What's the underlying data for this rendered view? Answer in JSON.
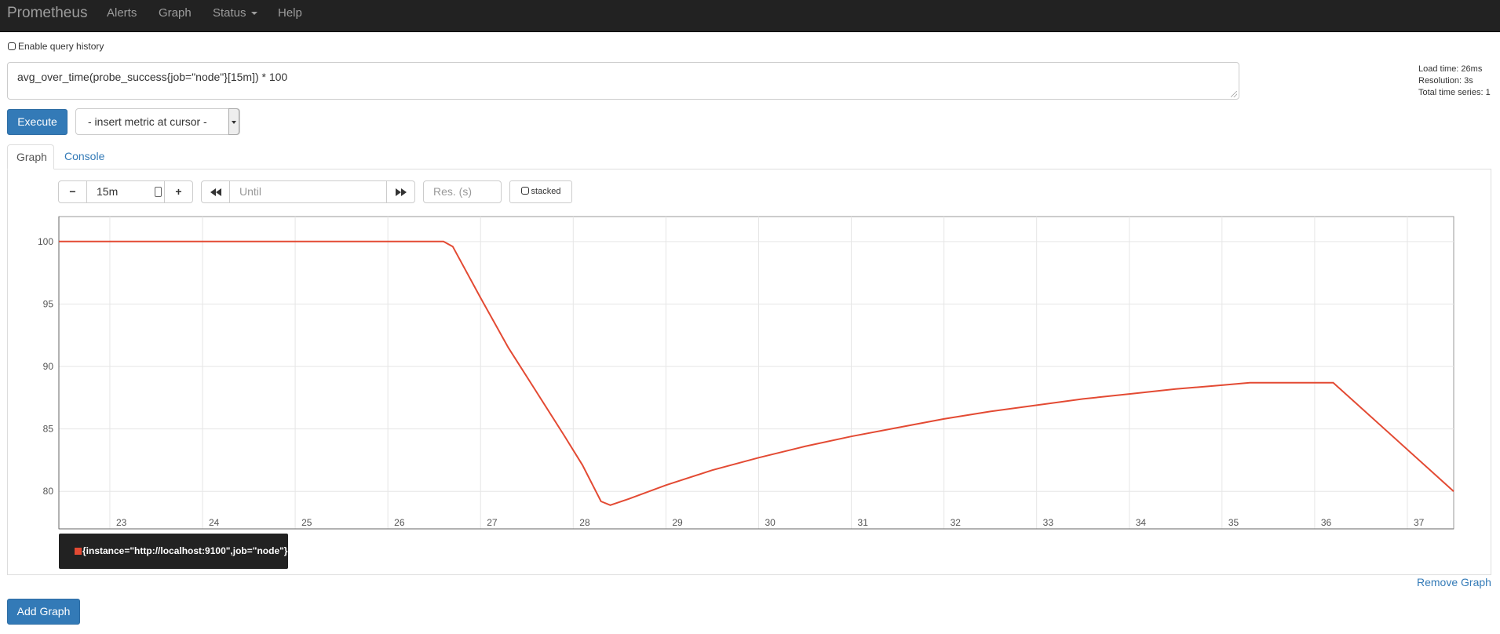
{
  "navbar": {
    "brand": "Prometheus",
    "items": [
      {
        "label": "Alerts"
      },
      {
        "label": "Graph"
      },
      {
        "label": "Status"
      },
      {
        "label": "Help"
      }
    ]
  },
  "query_history": {
    "label": "Enable query history",
    "checked": false
  },
  "expression": {
    "value": "avg_over_time(probe_success{job=\"node\"}[15m]) * 100"
  },
  "stats": {
    "load_time": "Load time: 26ms",
    "resolution": "Resolution: 3s",
    "total_series": "Total time series: 1"
  },
  "execute_label": "Execute",
  "metric_select": {
    "value": "- insert metric at cursor -"
  },
  "tabs": [
    {
      "label": "Graph",
      "active": true
    },
    {
      "label": "Console",
      "active": false
    }
  ],
  "controls": {
    "range_minus": "−",
    "range_value": "15m",
    "range_plus": "+",
    "until_placeholder": "Until",
    "res_placeholder": "Res. (s)",
    "stacked_label": "stacked"
  },
  "chart_data": {
    "type": "line",
    "x_tick_labels": [
      "23",
      "24",
      "25",
      "26",
      "27",
      "28",
      "29",
      "30",
      "31",
      "32",
      "33",
      "34",
      "35",
      "36",
      "37"
    ],
    "y_tick_labels": [
      "100",
      "95",
      "90",
      "85",
      "80"
    ],
    "xlim": [
      22.45,
      37.5
    ],
    "ylim": [
      77,
      102
    ],
    "grid": true,
    "color": "#e34a33",
    "series": [
      {
        "name": "{instance=\"http://localhost:9100\",job=\"node\"}",
        "x": [
          22.45,
          26.6,
          26.7,
          27.0,
          27.3,
          27.6,
          27.9,
          28.1,
          28.3,
          28.4,
          28.6,
          29.0,
          29.5,
          30.0,
          30.5,
          31.0,
          31.5,
          32.0,
          32.5,
          33.0,
          33.5,
          34.0,
          34.5,
          35.0,
          35.3,
          36.2,
          37.5
        ],
        "y": [
          100,
          100,
          99.6,
          95.5,
          91.5,
          88.0,
          84.5,
          82.1,
          79.2,
          78.9,
          79.4,
          80.5,
          81.7,
          82.7,
          83.6,
          84.4,
          85.1,
          85.8,
          86.4,
          86.9,
          87.4,
          87.8,
          88.2,
          88.5,
          88.7,
          88.7,
          80.0
        ]
      }
    ]
  },
  "legend": {
    "label": "{instance=\"http://localhost:9100\",job=\"node\"}"
  },
  "remove_graph_label": "Remove Graph",
  "add_graph_label": "Add Graph"
}
